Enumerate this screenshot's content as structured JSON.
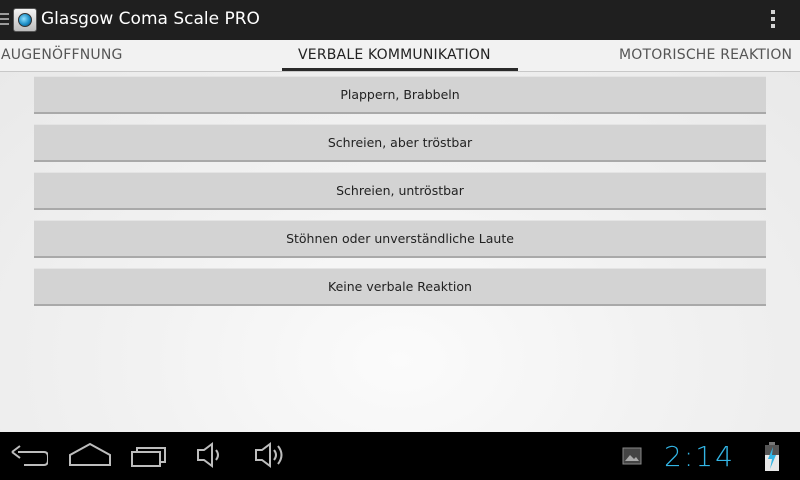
{
  "app": {
    "title": "Glasgow Coma Scale PRO",
    "icons": {
      "menu": "hamburger-icon",
      "app": "app-icon",
      "overflow": "overflow-menu-icon"
    }
  },
  "tabs": [
    {
      "label": "AUGENÖFFNUNG",
      "selected": false
    },
    {
      "label": "VERBALE KOMMUNIKATION",
      "selected": true
    },
    {
      "label": "MOTORISCHE REAKTION",
      "selected": false
    }
  ],
  "options": [
    {
      "label": "Plappern, Brabbeln"
    },
    {
      "label": "Schreien, aber tröstbar"
    },
    {
      "label": "Schreien, untröstbar"
    },
    {
      "label": "Stöhnen oder unverständliche Laute"
    },
    {
      "label": "Keine verbale Reaktion"
    }
  ],
  "nav_bar": {
    "icons": [
      "back-icon",
      "home-icon",
      "recent-apps-icon",
      "volume-down-icon",
      "volume-up-icon",
      "gallery-icon",
      "battery-charging-icon"
    ],
    "clock": "2:14"
  },
  "colors": {
    "accent": "#33b5e5",
    "action_bar": "#1f1f1f",
    "button": "#d3d3d3"
  }
}
